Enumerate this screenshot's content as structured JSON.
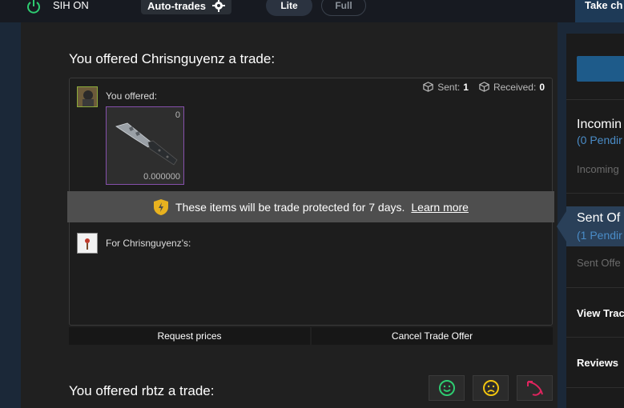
{
  "topbar": {
    "status_label": "SIH ON",
    "autotrades_label": "Auto-trades",
    "toggle_lite": "Lite",
    "toggle_full": "Full",
    "take_label": "Take ch"
  },
  "offers": [
    {
      "title": "You offered Chrisnguyenz a trade:",
      "you_offered_label": "You offered:",
      "sent_label": "Sent:",
      "sent_value": "1",
      "received_label": "Received:",
      "received_value": "0",
      "item": {
        "count": "0",
        "price": "0.000000",
        "icon": "knife-item"
      },
      "protection_text": "These items will be trade protected for 7 days.",
      "learn_more": "Learn more",
      "for_label": "For Chrisnguyenz's:",
      "request_prices": "Request prices",
      "cancel_offer": "Cancel Trade Offer"
    },
    {
      "title": "You offered rbtz a trade:"
    }
  ],
  "reactions": [
    "smile-icon",
    "frown-icon",
    "counter-icon"
  ],
  "colors": {
    "accent_blue": "#4a8cc7",
    "smile": "#2ecc71",
    "frown": "#f1c40f",
    "counter": "#e0245e",
    "item_border": "#8650ac"
  },
  "sidebar": {
    "incoming_title": "Incomin",
    "incoming_sub": "(0 Pendir",
    "incoming_dim": "Incoming",
    "sent_title": "Sent Of",
    "sent_sub": "(1 Pendir",
    "sent_dim": "Sent Offe",
    "view_trade": "View Trac",
    "reviews": "Reviews"
  }
}
